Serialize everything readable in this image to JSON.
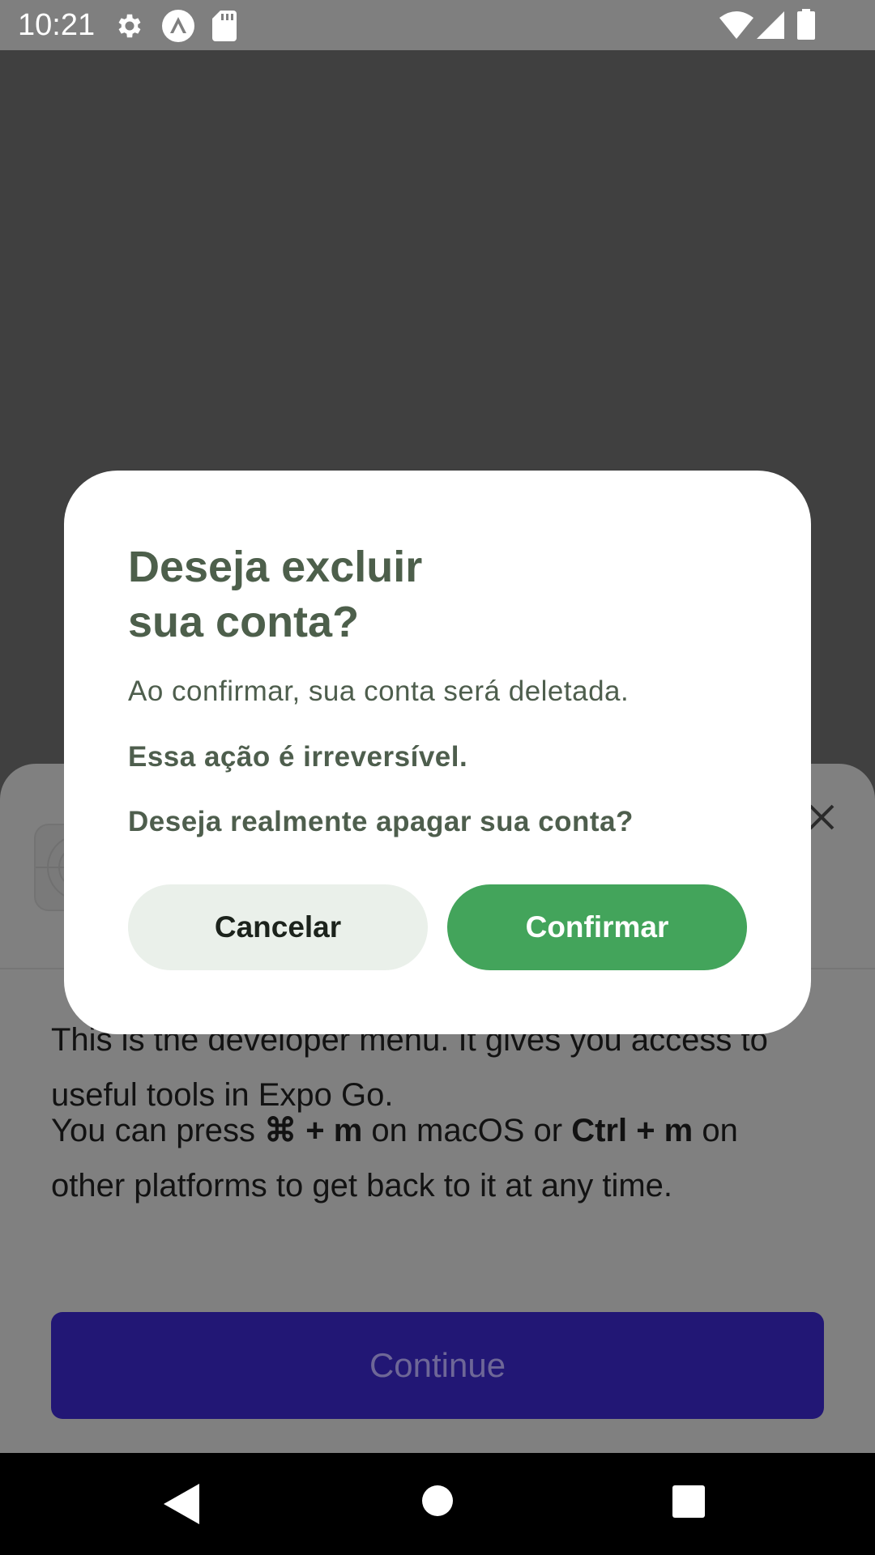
{
  "status_bar": {
    "time": "10:21",
    "left_icons": [
      "gear-icon",
      "expo-icon",
      "sd-card-icon"
    ],
    "right_icons": [
      "wifi-icon",
      "signal-icon",
      "battery-icon"
    ]
  },
  "dev_menu": {
    "intro_text": "This is the developer menu. It gives you access to useful tools in Expo Go.",
    "shortcut": {
      "prefix": "You can press ",
      "mac_keys": "⌘ + m",
      "mid": " on macOS or ",
      "other_keys": "Ctrl + m",
      "suffix": " on other platforms to get back to it at any time."
    },
    "continue_label": "Continue",
    "close_icon": "close-icon"
  },
  "dialog": {
    "title": "Deseja excluir\nsua conta?",
    "message": "Ao confirmar, sua conta será deletada.",
    "warning": "Essa ação é irreversível.",
    "question": "Deseja realmente apagar sua conta?",
    "cancel_label": "Cancelar",
    "confirm_label": "Confirmar"
  },
  "nav_bar": {
    "buttons": [
      "back-icon",
      "home-icon",
      "recents-icon"
    ]
  },
  "colors": {
    "dialog_title": "#4d5f4b",
    "confirm": "#43a45b",
    "cancel_bg": "#eaf0ea",
    "continue_bg": "#221775"
  }
}
